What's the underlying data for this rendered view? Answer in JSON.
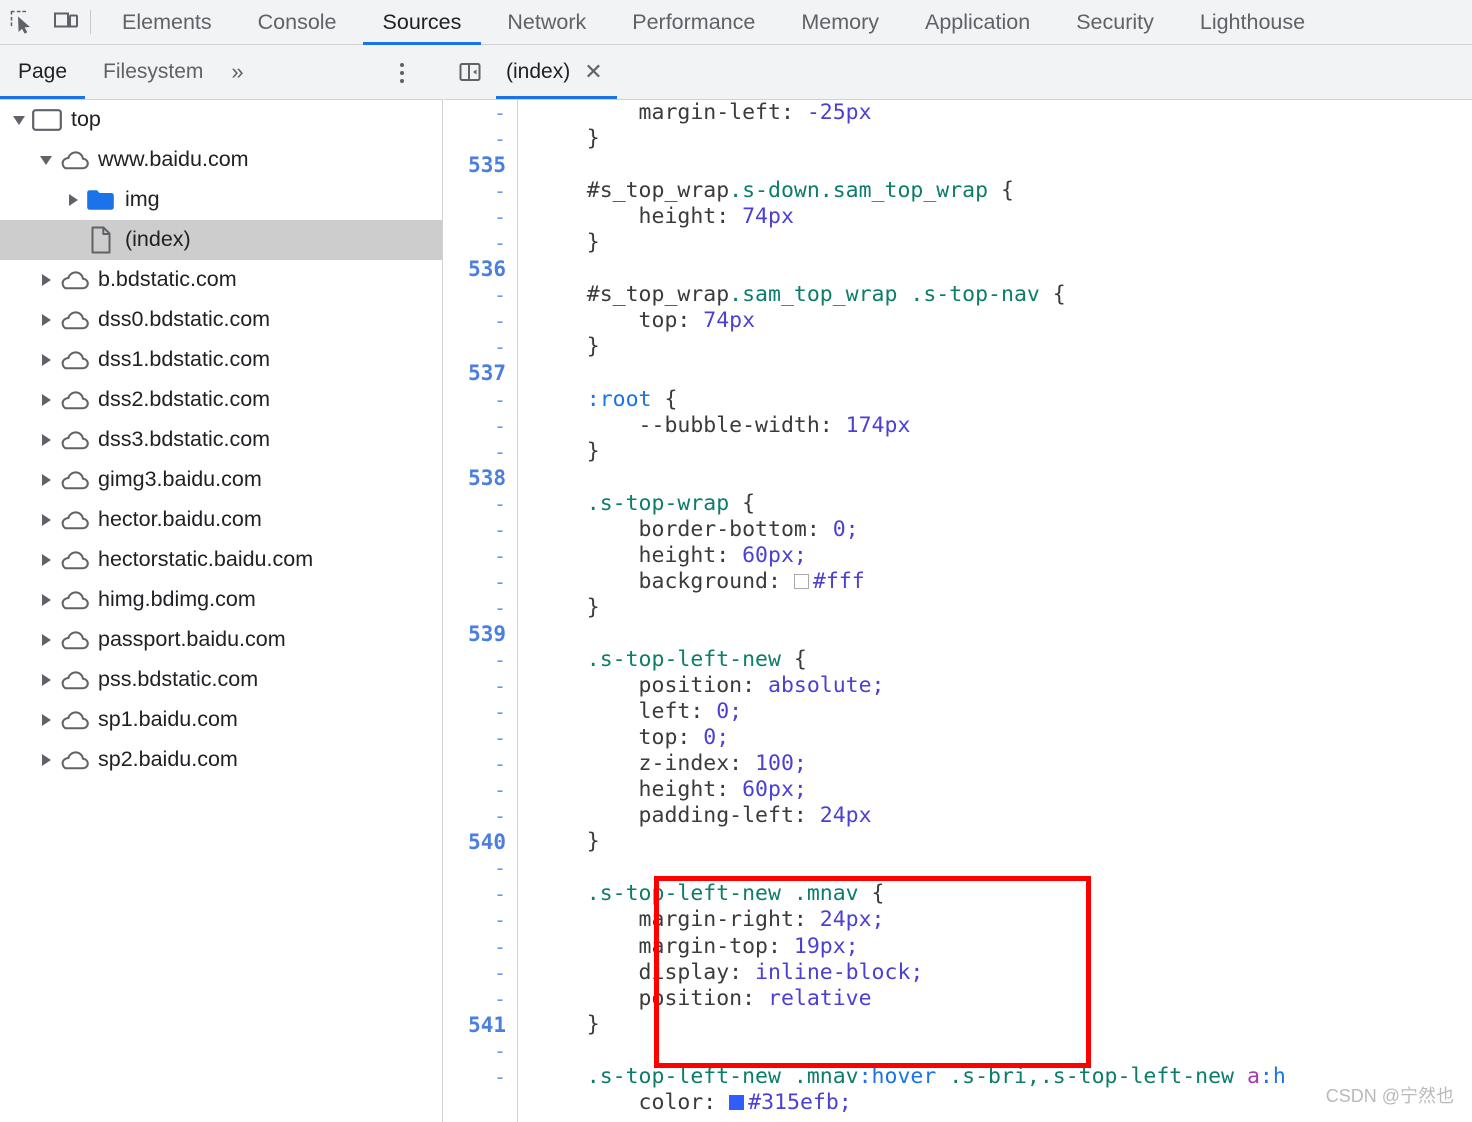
{
  "toolbar": {
    "inspect_icon": "inspect-element-icon",
    "device_icon": "device-toolbar-icon",
    "tabs": [
      {
        "label": "Elements",
        "active": false
      },
      {
        "label": "Console",
        "active": false
      },
      {
        "label": "Sources",
        "active": true
      },
      {
        "label": "Network",
        "active": false
      },
      {
        "label": "Performance",
        "active": false
      },
      {
        "label": "Memory",
        "active": false
      },
      {
        "label": "Application",
        "active": false
      },
      {
        "label": "Security",
        "active": false
      },
      {
        "label": "Lighthouse",
        "active": false
      }
    ]
  },
  "navigator_header": {
    "tabs": [
      {
        "label": "Page",
        "active": true
      },
      {
        "label": "Filesystem",
        "active": false
      }
    ],
    "more_label": "»",
    "menu_icon": "kebab-menu-icon"
  },
  "editor_header": {
    "collapse_icon": "collapse-sidebar-icon",
    "file_tab": "(index)",
    "close_label": "✕"
  },
  "tree": [
    {
      "label": "top",
      "indent": 0,
      "twisty": "open",
      "icon": "frame-icon",
      "selected": false
    },
    {
      "label": "www.baidu.com",
      "indent": 1,
      "twisty": "open",
      "icon": "cloud-icon",
      "selected": false
    },
    {
      "label": "img",
      "indent": 2,
      "twisty": "closed",
      "icon": "folder-icon",
      "selected": false
    },
    {
      "label": "(index)",
      "indent": 2,
      "twisty": "none",
      "icon": "file-icon",
      "selected": true
    },
    {
      "label": "b.bdstatic.com",
      "indent": 1,
      "twisty": "closed",
      "icon": "cloud-icon",
      "selected": false
    },
    {
      "label": "dss0.bdstatic.com",
      "indent": 1,
      "twisty": "closed",
      "icon": "cloud-icon",
      "selected": false
    },
    {
      "label": "dss1.bdstatic.com",
      "indent": 1,
      "twisty": "closed",
      "icon": "cloud-icon",
      "selected": false
    },
    {
      "label": "dss2.bdstatic.com",
      "indent": 1,
      "twisty": "closed",
      "icon": "cloud-icon",
      "selected": false
    },
    {
      "label": "dss3.bdstatic.com",
      "indent": 1,
      "twisty": "closed",
      "icon": "cloud-icon",
      "selected": false
    },
    {
      "label": "gimg3.baidu.com",
      "indent": 1,
      "twisty": "closed",
      "icon": "cloud-icon",
      "selected": false
    },
    {
      "label": "hector.baidu.com",
      "indent": 1,
      "twisty": "closed",
      "icon": "cloud-icon",
      "selected": false
    },
    {
      "label": "hectorstatic.baidu.com",
      "indent": 1,
      "twisty": "closed",
      "icon": "cloud-icon",
      "selected": false
    },
    {
      "label": "himg.bdimg.com",
      "indent": 1,
      "twisty": "closed",
      "icon": "cloud-icon",
      "selected": false
    },
    {
      "label": "passport.baidu.com",
      "indent": 1,
      "twisty": "closed",
      "icon": "cloud-icon",
      "selected": false
    },
    {
      "label": "pss.bdstatic.com",
      "indent": 1,
      "twisty": "closed",
      "icon": "cloud-icon",
      "selected": false
    },
    {
      "label": "sp1.baidu.com",
      "indent": 1,
      "twisty": "closed",
      "icon": "cloud-icon",
      "selected": false
    },
    {
      "label": "sp2.baidu.com",
      "indent": 1,
      "twisty": "closed",
      "icon": "cloud-icon",
      "selected": false
    }
  ],
  "editor": {
    "gutter": [
      "-",
      "-",
      "535",
      "-",
      "-",
      "-",
      "536",
      "-",
      "-",
      "-",
      "537",
      "-",
      "-",
      "-",
      "538",
      "-",
      "-",
      "-",
      "-",
      "-",
      "539",
      "-",
      "-",
      "-",
      "-",
      "-",
      "-",
      "-",
      "540",
      "-",
      "-",
      "-",
      "-",
      "-",
      "-",
      "541",
      "-",
      "-"
    ],
    "lines": [
      [
        {
          "t": "        margin-left: ",
          "c": "prop"
        },
        {
          "t": "-25px",
          "c": "val"
        }
      ],
      [
        {
          "t": "    }",
          "c": "punc"
        }
      ],
      [
        {
          "t": "",
          "c": "punc"
        }
      ],
      [
        {
          "t": "    #s_top_wrap",
          "c": "sel-id"
        },
        {
          "t": ".s-down.sam_top_wrap",
          "c": "sel-class"
        },
        {
          "t": " {",
          "c": "punc"
        }
      ],
      [
        {
          "t": "        height: ",
          "c": "prop"
        },
        {
          "t": "74px",
          "c": "val"
        }
      ],
      [
        {
          "t": "    }",
          "c": "punc"
        }
      ],
      [
        {
          "t": "",
          "c": "punc"
        }
      ],
      [
        {
          "t": "    #s_top_wrap",
          "c": "sel-id"
        },
        {
          "t": ".sam_top_wrap .s-top-nav",
          "c": "sel-class"
        },
        {
          "t": " {",
          "c": "punc"
        }
      ],
      [
        {
          "t": "        top: ",
          "c": "prop"
        },
        {
          "t": "74px",
          "c": "val"
        }
      ],
      [
        {
          "t": "    }",
          "c": "punc"
        }
      ],
      [
        {
          "t": "",
          "c": "punc"
        }
      ],
      [
        {
          "t": "    :root",
          "c": "sel-pseudo"
        },
        {
          "t": " {",
          "c": "punc"
        }
      ],
      [
        {
          "t": "        --bubble-width: ",
          "c": "prop"
        },
        {
          "t": "174px",
          "c": "val"
        }
      ],
      [
        {
          "t": "    }",
          "c": "punc"
        }
      ],
      [
        {
          "t": "",
          "c": "punc"
        }
      ],
      [
        {
          "t": "    .s-top-wrap",
          "c": "sel-class"
        },
        {
          "t": " {",
          "c": "punc"
        }
      ],
      [
        {
          "t": "        border-bottom: ",
          "c": "prop"
        },
        {
          "t": "0;",
          "c": "val"
        }
      ],
      [
        {
          "t": "        height: ",
          "c": "prop"
        },
        {
          "t": "60px;",
          "c": "val"
        }
      ],
      [
        {
          "t": "        background: ",
          "c": "prop"
        },
        {
          "t": "SWATCH_WHITE",
          "c": "swatch-white"
        },
        {
          "t": "#fff",
          "c": "val"
        }
      ],
      [
        {
          "t": "    }",
          "c": "punc"
        }
      ],
      [
        {
          "t": "",
          "c": "punc"
        }
      ],
      [
        {
          "t": "    .s-top-left-new",
          "c": "sel-class"
        },
        {
          "t": " {",
          "c": "punc"
        }
      ],
      [
        {
          "t": "        position: ",
          "c": "prop"
        },
        {
          "t": "absolute;",
          "c": "val"
        }
      ],
      [
        {
          "t": "        left: ",
          "c": "prop"
        },
        {
          "t": "0;",
          "c": "val"
        }
      ],
      [
        {
          "t": "        top: ",
          "c": "prop"
        },
        {
          "t": "0;",
          "c": "val"
        }
      ],
      [
        {
          "t": "        z-index: ",
          "c": "prop"
        },
        {
          "t": "100;",
          "c": "val"
        }
      ],
      [
        {
          "t": "        height: ",
          "c": "prop"
        },
        {
          "t": "60px;",
          "c": "val"
        }
      ],
      [
        {
          "t": "        padding-left: ",
          "c": "prop"
        },
        {
          "t": "24px",
          "c": "val"
        }
      ],
      [
        {
          "t": "    }",
          "c": "punc"
        }
      ],
      [
        {
          "t": "",
          "c": "punc"
        }
      ],
      [
        {
          "t": "    .s-top-left-new .mnav",
          "c": "sel-class"
        },
        {
          "t": " {",
          "c": "punc"
        }
      ],
      [
        {
          "t": "        margin-right: ",
          "c": "prop"
        },
        {
          "t": "24px;",
          "c": "val"
        }
      ],
      [
        {
          "t": "        margin-top: ",
          "c": "prop"
        },
        {
          "t": "19px;",
          "c": "val"
        }
      ],
      [
        {
          "t": "        display: ",
          "c": "prop"
        },
        {
          "t": "inline-block;",
          "c": "val"
        }
      ],
      [
        {
          "t": "        position: ",
          "c": "prop"
        },
        {
          "t": "relative",
          "c": "val"
        }
      ],
      [
        {
          "t": "    }",
          "c": "punc"
        }
      ],
      [
        {
          "t": "",
          "c": "punc"
        }
      ],
      [
        {
          "t": "    .s-top-left-new .mnav",
          "c": "sel-class"
        },
        {
          "t": ":hover",
          "c": "sel-pseudo"
        },
        {
          "t": " .s-bri,.s-top-left-new ",
          "c": "sel-class"
        },
        {
          "t": "a",
          "c": "sel-elem"
        },
        {
          "t": ":h",
          "c": "sel-pseudo"
        }
      ],
      [
        {
          "t": "        color: ",
          "c": "prop"
        },
        {
          "t": "SWATCH_BLUE",
          "c": "swatch-blue"
        },
        {
          "t": "#315efb;",
          "c": "val"
        }
      ]
    ]
  },
  "annotation": {
    "highlight_color": "#ff0000"
  },
  "watermark": {
    "text": "CSDN @宁然也"
  }
}
